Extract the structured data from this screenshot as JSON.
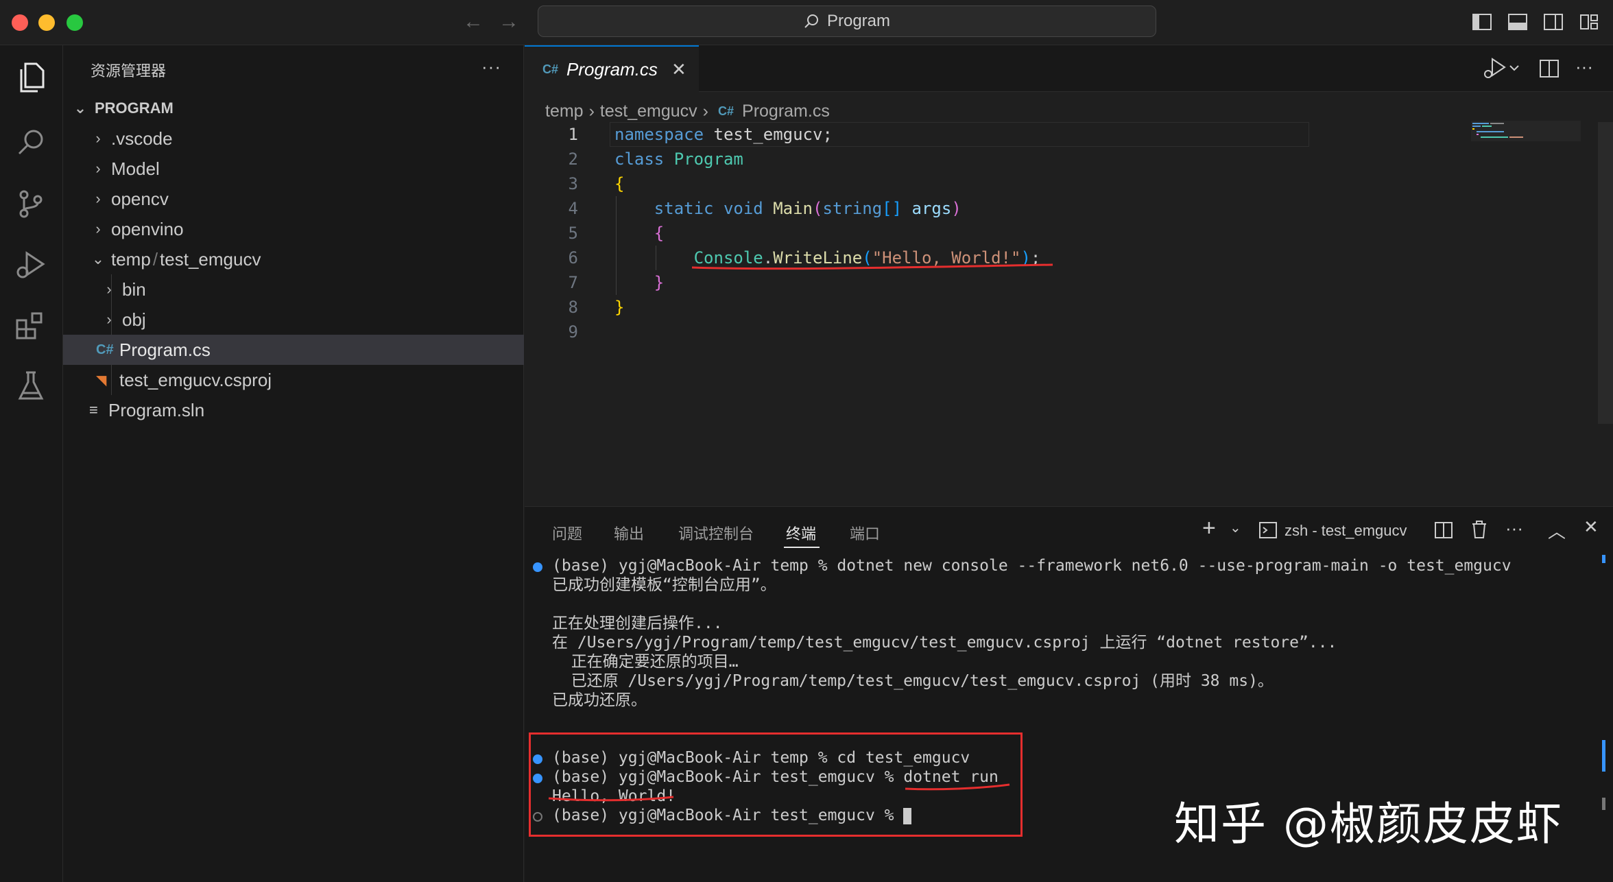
{
  "titlebar": {
    "search_label": "Program"
  },
  "sidebar": {
    "title": "资源管理器",
    "more": "···",
    "root": "PROGRAM",
    "items": [
      {
        "label": ".vscode",
        "type": "folder-collapsed"
      },
      {
        "label": "Model",
        "type": "folder-collapsed"
      },
      {
        "label": "opencv",
        "type": "folder-collapsed"
      },
      {
        "label": "openvino",
        "type": "folder-collapsed"
      },
      {
        "label_a": "temp",
        "label_sep": "/",
        "label_b": "test_emgucv",
        "type": "folder-expanded"
      },
      {
        "label": "bin",
        "type": "folder-collapsed"
      },
      {
        "label": "obj",
        "type": "folder-collapsed"
      },
      {
        "label": "Program.cs",
        "type": "csharp-file",
        "selected": true
      },
      {
        "label": "test_emgucv.csproj",
        "type": "rss-file"
      },
      {
        "label": "Program.sln",
        "type": "sln-file"
      }
    ]
  },
  "editor": {
    "tab_title": "Program.cs",
    "breadcrumbs": [
      "temp",
      "test_emgucv",
      "Program.cs"
    ],
    "line_numbers": [
      "1",
      "2",
      "3",
      "4",
      "5",
      "6",
      "7",
      "8",
      "9"
    ]
  },
  "panel": {
    "tabs": [
      "问题",
      "输出",
      "调试控制台",
      "终端",
      "端口"
    ],
    "active_tab": "终端",
    "terminal_name": "zsh - test_emgucv",
    "lines": [
      "(base) ygj@MacBook-Air temp % dotnet new console --framework net6.0 --use-program-main -o test_emgucv",
      "已成功创建模板“控制台应用”。",
      "",
      "正在处理创建后操作...",
      "在 /Users/ygj/Program/temp/test_emgucv/test_emgucv.csproj 上运行 “dotnet restore”...",
      "  正在确定要还原的项目…",
      "  已还原 /Users/ygj/Program/temp/test_emgucv/test_emgucv.csproj (用时 38 ms)。",
      "已成功还原。",
      "",
      "(base) ygj@MacBook-Air temp % cd test_emgucv",
      "(base) ygj@MacBook-Air test_emgucv % dotnet run",
      "Hello, World!",
      "(base) ygj@MacBook-Air test_emgucv % "
    ]
  },
  "watermark": "知乎 @椒颜皮皮虾",
  "colors": {
    "accent": "#0078d4",
    "annotation_red": "#e52e2e",
    "keyword": "#569cd6",
    "class": "#4ec9b0",
    "string": "#ce9178"
  }
}
